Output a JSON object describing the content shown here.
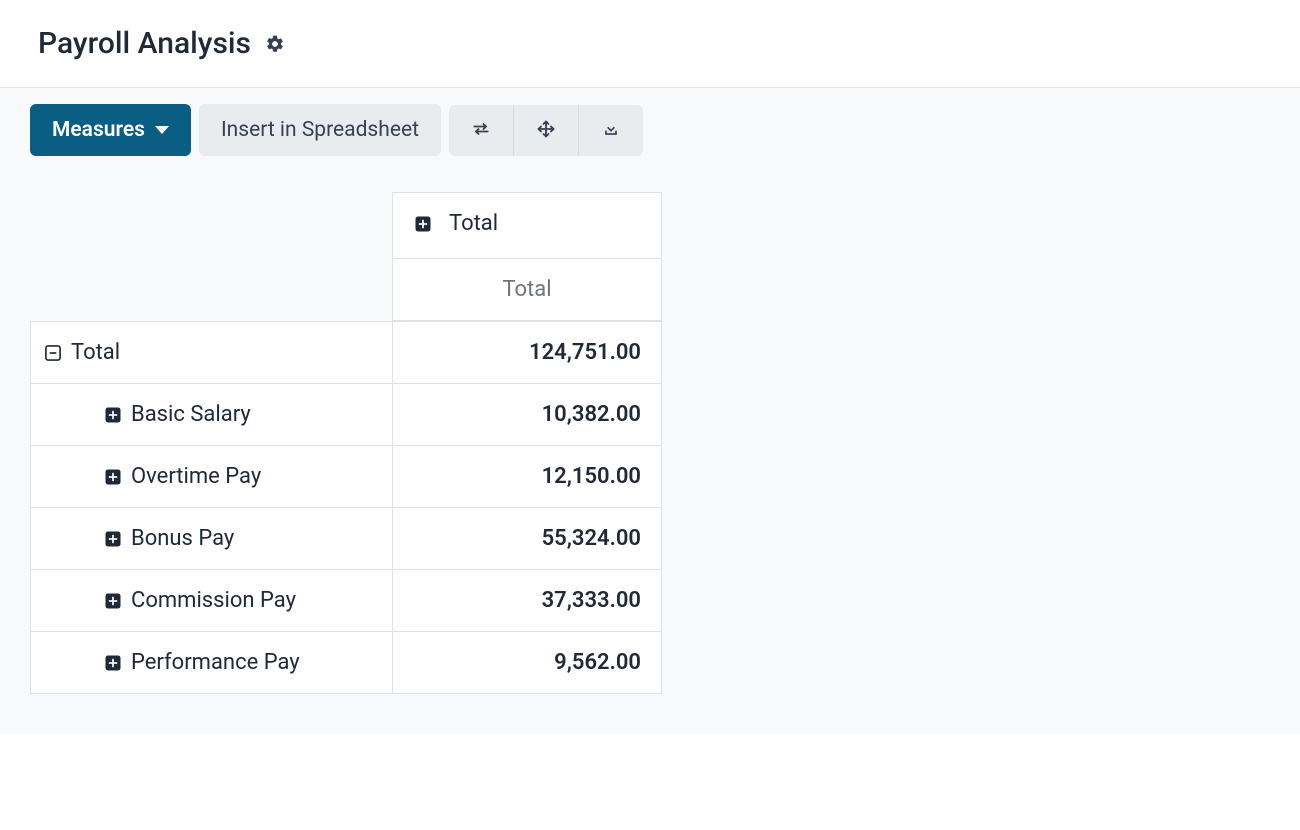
{
  "header": {
    "title": "Payroll Analysis"
  },
  "toolbar": {
    "measures_label": "Measures",
    "insert_label": "Insert in Spreadsheet"
  },
  "pivot": {
    "col_header_top": "Total",
    "col_header_sub": "Total",
    "rows": [
      {
        "label": "Total",
        "value": "124,751.00",
        "expanded": true,
        "indent": 0
      },
      {
        "label": "Basic Salary",
        "value": "10,382.00",
        "expanded": false,
        "indent": 1
      },
      {
        "label": "Overtime Pay",
        "value": "12,150.00",
        "expanded": false,
        "indent": 1
      },
      {
        "label": "Bonus Pay",
        "value": "55,324.00",
        "expanded": false,
        "indent": 1
      },
      {
        "label": "Commission Pay",
        "value": "37,333.00",
        "expanded": false,
        "indent": 1
      },
      {
        "label": "Performance Pay",
        "value": "9,562.00",
        "expanded": false,
        "indent": 1
      }
    ]
  }
}
